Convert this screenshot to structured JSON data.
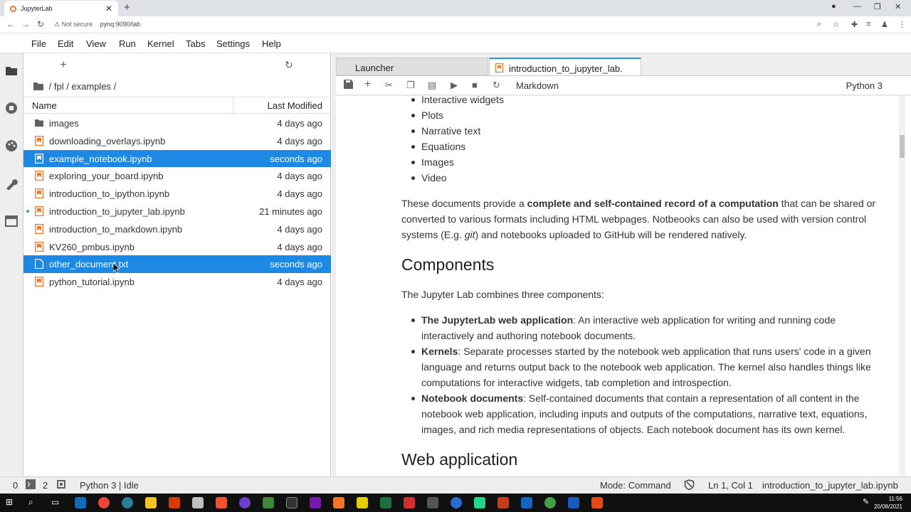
{
  "browser": {
    "tab_title": "JupyterLab",
    "not_secure": "Not secure",
    "url": "pynq:9090/lab"
  },
  "menu": [
    "File",
    "Edit",
    "View",
    "Run",
    "Kernel",
    "Tabs",
    "Settings",
    "Help"
  ],
  "filebrowser": {
    "breadcrumb": "/ fpl / examples /",
    "col_name": "Name",
    "col_modified": "Last Modified",
    "files": [
      {
        "name": "images",
        "modified": "4 days ago",
        "icon": "folder-icon"
      },
      {
        "name": "downloading_overlays.ipynb",
        "modified": "4 days ago",
        "icon": "notebook-icon"
      },
      {
        "name": "example_notebook.ipynb",
        "modified": "seconds ago",
        "icon": "notebook-icon"
      },
      {
        "name": "exploring_your_board.ipynb",
        "modified": "4 days ago",
        "icon": "notebook-icon"
      },
      {
        "name": "introduction_to_ipython.ipynb",
        "modified": "4 days ago",
        "icon": "notebook-icon"
      },
      {
        "name": "introduction_to_jupyter_lab.ipynb",
        "modified": "21 minutes ago",
        "icon": "notebook-icon"
      },
      {
        "name": "introduction_to_markdown.ipynb",
        "modified": "4 days ago",
        "icon": "notebook-icon"
      },
      {
        "name": "KV260_pmbus.ipynb",
        "modified": "4 days ago",
        "icon": "notebook-icon"
      },
      {
        "name": "other_document.txt",
        "modified": "seconds ago",
        "icon": "text-file-icon"
      },
      {
        "name": "python_tutorial.ipynb",
        "modified": "4 days ago",
        "icon": "notebook-icon"
      }
    ]
  },
  "tabs": {
    "launcher": "Launcher",
    "notebook": "introduction_to_jupyter_lab."
  },
  "toolbar": {
    "cell_type": "Markdown",
    "kernel": "Python 3"
  },
  "notebook": {
    "list1": [
      "Interactive widgets",
      "Plots",
      "Narrative text",
      "Equations",
      "Images",
      "Video"
    ],
    "p1_a": "These documents provide a ",
    "p1_b": "complete and self-contained record of a computation",
    "p1_c": " that can be shared or converted to various formats including HTML webpages. Notbeooks can also be used with version control systems (E.g. ",
    "p1_d": "git",
    "p1_e": ") and notebooks uploaded to GitHub will be rendered natively.",
    "h_components": "Components",
    "p2": "The Jupyter Lab combines three components:",
    "c1_b": "The JupyterLab web application",
    "c1_t": ": An interactive web application for writing and running code interactively and authoring notebook documents.",
    "c2_b": "Kernels",
    "c2_t": ": Separate processes started by the notebook web application that runs users' code in a given language and returns output back to the notebook web application. The kernel also handles things like computations for interactive widgets, tab completion and introspection.",
    "c3_b": "Notebook documents",
    "c3_t": ": Self-contained documents that contain a representation of all content in the notebook web application, including inputs and outputs of the computations, narrative text, equations, images, and rich media representations of objects. Each notebook document has its own kernel.",
    "h_next": "Web application"
  },
  "status": {
    "zero": "0",
    "two": "2",
    "kernel": "Python 3 | Idle",
    "mode": "Mode: Command",
    "position": "Ln 1, Col 1",
    "file": "introduction_to_jupyter_lab.ipynb"
  },
  "clock": {
    "time": "11:56",
    "date": "20/08/2021"
  }
}
